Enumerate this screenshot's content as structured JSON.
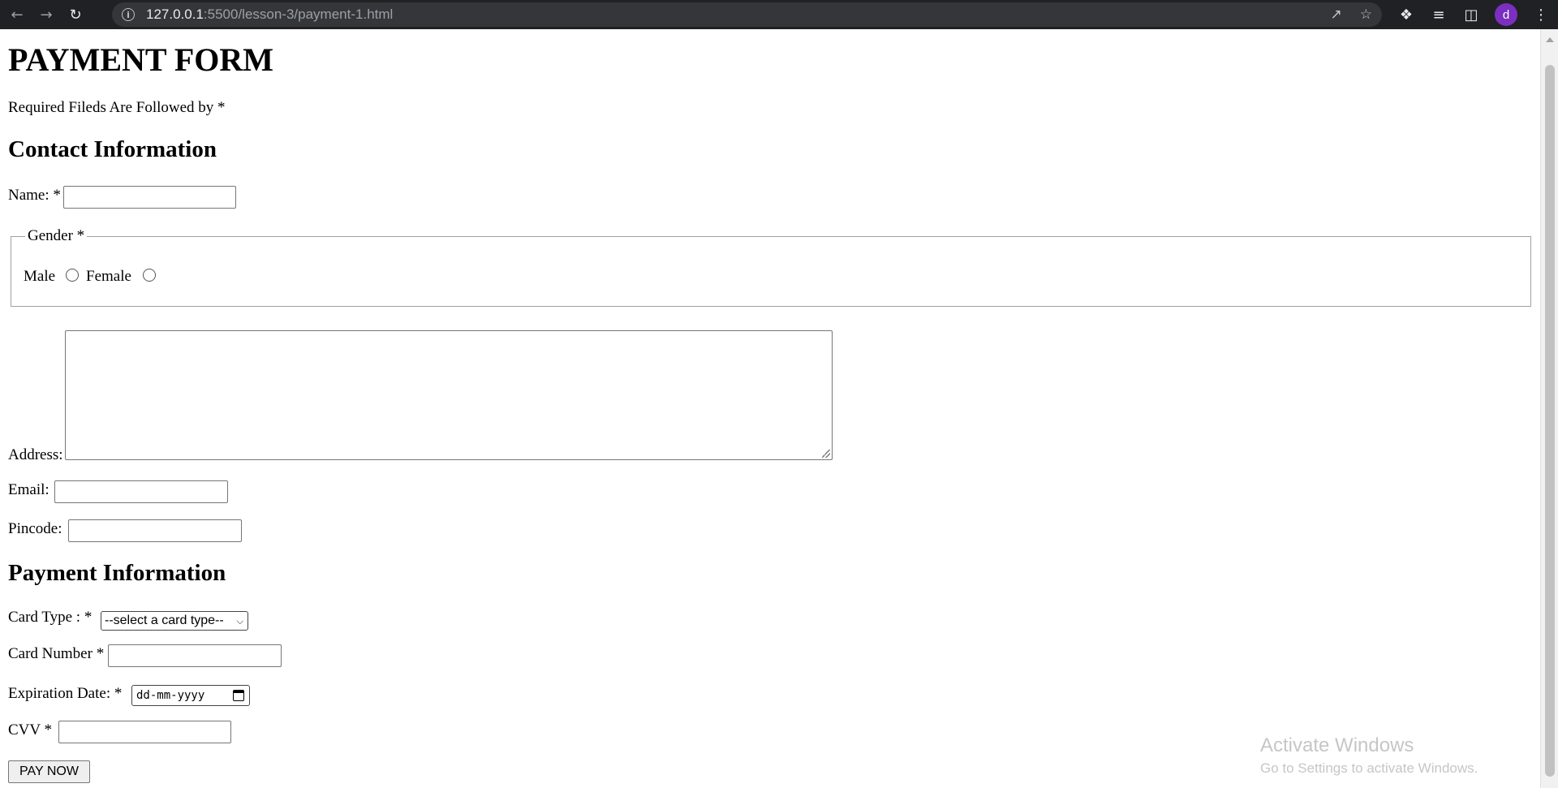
{
  "browser": {
    "url_host": "127.0.0.1",
    "url_rest": ":5500/lesson-3/payment-1.html",
    "profile_initial": "d",
    "icons": [
      "back-icon",
      "forward-icon",
      "reload-icon",
      "info-icon",
      "share-icon",
      "star-icon",
      "extensions-icon",
      "reading-list-icon",
      "side-panel-icon",
      "menu-icon"
    ]
  },
  "form": {
    "title": "PAYMENT FORM",
    "required_note": "Required Fileds Are Followed by *",
    "contact": {
      "heading": "Contact Information",
      "name_label": "Name: *",
      "name_value": "",
      "gender_legend": "Gender *",
      "male_label": "Male",
      "female_label": "Female",
      "address_label": "Address:",
      "address_value": "",
      "email_label": "Email:",
      "email_value": "",
      "pincode_label": "Pincode:",
      "pincode_value": ""
    },
    "payment": {
      "heading": "Payment Information",
      "card_type_label": "Card Type : *",
      "card_type_selected": "--select a card type--",
      "card_number_label": "Card Number *",
      "card_number_value": "",
      "expiration_label": "Expiration Date: *",
      "expiration_placeholder": "dd-mm-yyyy",
      "cvv_label": "CVV *",
      "cvv_value": ""
    },
    "submit_label": "PAY NOW"
  },
  "watermark": {
    "line1": "Activate Windows",
    "line2": "Go to Settings to activate Windows."
  }
}
